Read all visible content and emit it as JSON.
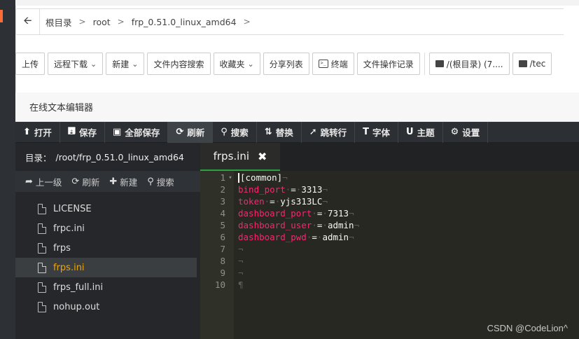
{
  "breadcrumb": {
    "items": [
      "根目录",
      "root",
      "frp_0.51.0_linux_amd64"
    ],
    "separator": ">"
  },
  "toolbar": {
    "upload": "上传",
    "remote_download": "远程下载",
    "new": "新建",
    "content_search": "文件内容搜索",
    "favorites": "收藏夹",
    "share_list": "分享列表",
    "terminal": "终端",
    "op_log": "文件操作记录",
    "disk_root": "/(根目录) (7....",
    "disk_2": "/tec"
  },
  "editor": {
    "title": "在线文本编辑器",
    "tools": {
      "open": "打开",
      "save": "保存",
      "save_all": "全部保存",
      "refresh": "刷新",
      "search": "搜索",
      "replace": "替换",
      "goto": "跳转行",
      "font": "字体",
      "theme": "主题",
      "settings": "设置"
    },
    "dir_label": "目录：",
    "dir_path": "/root/frp_0.51.0_linux_amd64",
    "sidebar_tools": {
      "up": "上一级",
      "refresh": "刷新",
      "new": "新建",
      "search": "搜索"
    },
    "files": [
      "LICENSE",
      "frpc.ini",
      "frps",
      "frps.ini",
      "frps_full.ini",
      "nohup.out"
    ],
    "active_file": "frps.ini",
    "tab_name": "frps.ini",
    "lines": [
      {
        "n": "1",
        "key": "",
        "val": "[common]",
        "end": "¬"
      },
      {
        "n": "2",
        "key": "bind_port",
        "val": "3313",
        "end": "¬"
      },
      {
        "n": "3",
        "key": "token",
        "val": "yjs313LC",
        "end": "¬"
      },
      {
        "n": "4",
        "key": "dashboard_port",
        "val": "7313",
        "end": "¬"
      },
      {
        "n": "5",
        "key": "dashboard_user",
        "val": "admin",
        "end": "¬"
      },
      {
        "n": "6",
        "key": "dashboard_pwd",
        "val": "admin",
        "end": "¬"
      },
      {
        "n": "7",
        "key": "",
        "val": "",
        "end": "¬"
      },
      {
        "n": "8",
        "key": "",
        "val": "",
        "end": "¬"
      },
      {
        "n": "9",
        "key": "",
        "val": "",
        "end": "¬"
      },
      {
        "n": "10",
        "key": "",
        "val": "",
        "end": "¶"
      }
    ]
  },
  "watermark": "CSDN @CodeLion^",
  "colors": {
    "keyword": "#f92672",
    "active_file": "#f0a500",
    "tab_underline": "#2ea043",
    "editor_bg": "#272822"
  }
}
